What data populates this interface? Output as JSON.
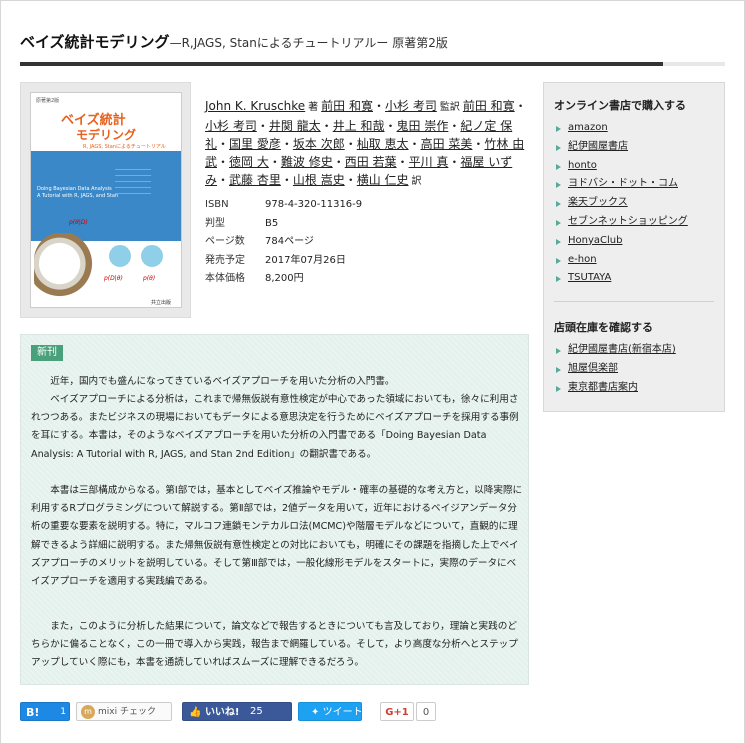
{
  "book": {
    "title": "ベイズ統計モデリング",
    "subtitle": "—R,JAGS, Stanによるチュートリアルー 原著第2版"
  },
  "cover": {
    "edition_label": "原著第2版",
    "title_line1": "ベイズ統計",
    "title_line2": "モデリング",
    "title_line3": "R, JAGS, Stanによるチュートリアル",
    "english_title": "Doing Bayesian Data Analysis",
    "english_sub": "A Tutorial with R, JAGS, and Stan",
    "formula": "p(θ|D)",
    "formula2": "p(D|θ)",
    "formula3": "p(θ)",
    "publisher": "共立出版"
  },
  "authors": {
    "author": "John K. Kruschke",
    "author_role": "著",
    "supervisors": [
      "前田 和寛",
      "小杉 考司"
    ],
    "supervisor_role": "監訳",
    "translators": [
      "前田 和寛",
      "小杉 考司",
      "井関 龍太",
      "井上 和哉",
      "鬼田 崇作",
      "紀ノ定 保礼",
      "国里 愛彦",
      "坂本 次郎",
      "杣取 恵太",
      "高田 菜美",
      "竹林 由武",
      "徳岡 大",
      "難波 修史",
      "西田 若葉",
      "平川 真",
      "福屋 いずみ",
      "武藤 杏里",
      "山根 嵩史",
      "横山 仁史"
    ],
    "translator_role": "訳"
  },
  "spec": [
    {
      "key": "ISBN",
      "value": "978-4-320-11316-9"
    },
    {
      "key": "判型",
      "value": "B5"
    },
    {
      "key": "ページ数",
      "value": "784ページ"
    },
    {
      "key": "発売予定",
      "value": "2017年07月26日"
    },
    {
      "key": "本体価格",
      "value": "8,200円"
    }
  ],
  "sidebar": {
    "online_heading": "オンライン書店で購入する",
    "online_stores": [
      "amazon",
      "紀伊國屋書店",
      "honto",
      "ヨドバシ・ドット・コム",
      "楽天ブックス",
      "セブンネットショッピング",
      "HonyaClub",
      "e-hon",
      "TSUTAYA"
    ],
    "store_heading": "店頭在庫を確認する",
    "physical_stores": [
      "紀伊國屋書店(新宿本店)",
      "旭屋倶楽部",
      "東京都書店案内"
    ]
  },
  "description": {
    "badge": "新刊",
    "paragraphs": [
      "近年，国内でも盛んになってきているベイズアプローチを用いた分析の入門書。",
      "ベイズアプローチによる分析は，これまで帰無仮説有意性検定が中心であった領域においても，徐々に利用されつつある。またビジネスの現場においてもデータによる意思決定を行うためにベイズアプローチを採用する事例を耳にする。本書は，そのようなベイズアプローチを用いた分析の入門書である「Doing Bayesian Data Analysis: A Tutorial with R, JAGS, and Stan 2nd Edition」の翻訳書である。",
      "本書は三部構成からなる。第Ⅰ部では，基本としてベイズ推論やモデル・確率の基礎的な考え方と，以降実際に利用するRプログラミングについて解説する。第Ⅱ部では，2値データを用いて，近年におけるベイジアンデータ分析の重要な要素を説明する。特に，マルコフ連鎖モンテカルロ法(MCMC)や階層モデルなどについて，直観的に理解できるよう詳細に説明する。また帰無仮説有意性検定との対比においても，明確にその課題を指摘した上でベイズアプローチのメリットを説明している。そして第Ⅲ部では，一般化線形モデルをスタートに，実際のデータにベイズアプローチを適用する実践編である。",
      "また，このように分析した結果について，論文などで報告するときについても言及しており，理論と実践のどちらかに偏ることなく，この一冊で導入から実践，報告まで網羅している。そして，より高度な分析へとステップアップしていく際にも，本書を通読していればスムーズに理解できるだろう。"
    ]
  },
  "social": {
    "hatena_label": "B!",
    "hatena_count": "1",
    "mixi_label": "mixi チェック",
    "facebook_label": "いいね!",
    "facebook_count": "25",
    "twitter_label": "ツイート",
    "gplus_label": "G+1",
    "gplus_count": "0"
  }
}
